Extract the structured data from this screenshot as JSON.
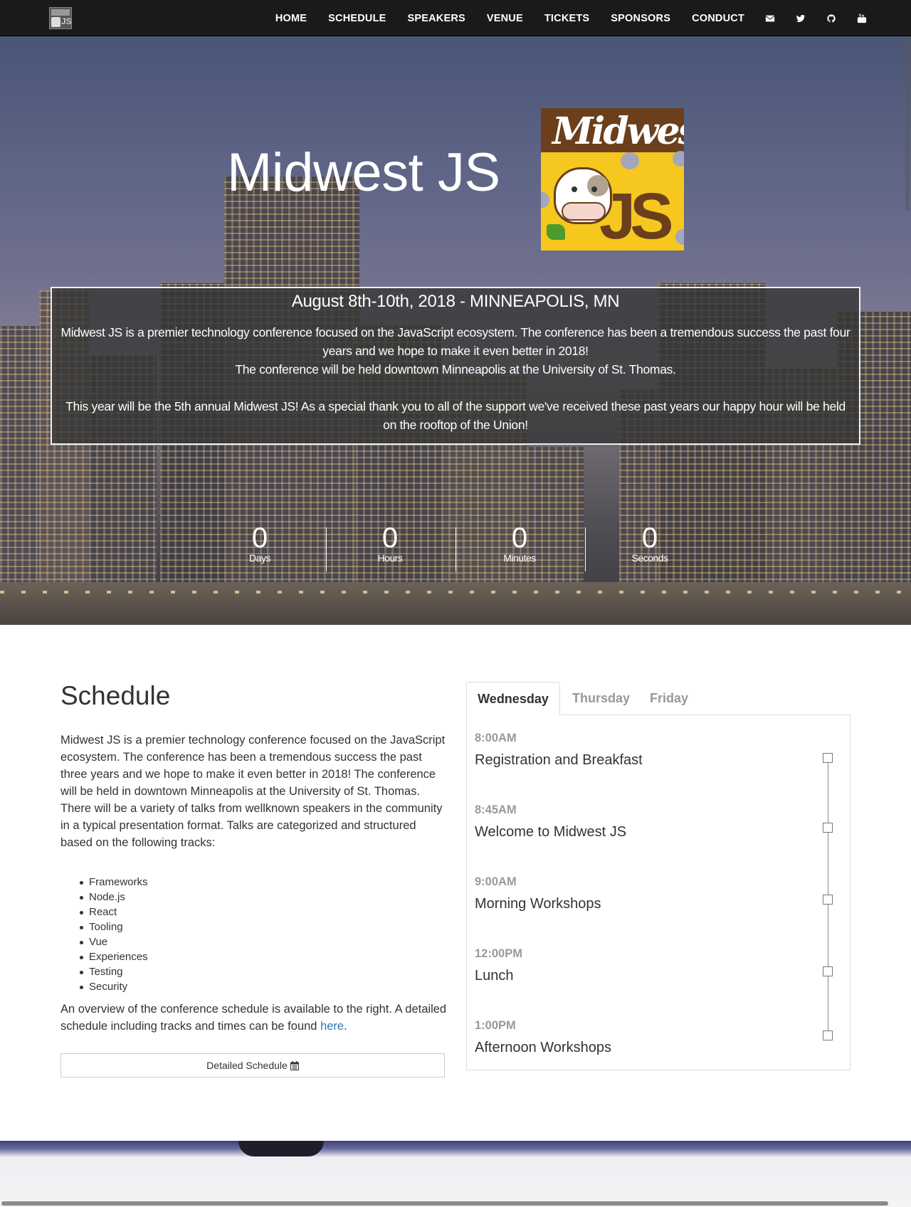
{
  "nav": {
    "links": [
      "HOME",
      "SCHEDULE",
      "SPEAKERS",
      "VENUE",
      "TICKETS",
      "SPONSORS",
      "CONDUCT"
    ],
    "icons": [
      "envelope-icon",
      "twitter-icon",
      "github-icon",
      "youtube-icon"
    ]
  },
  "hero": {
    "title": "Midwest JS",
    "logo_text": {
      "top": "Midwest",
      "bottom": "JS"
    },
    "date_line": "August 8th-10th, 2018 - MINNEAPOLIS, MN",
    "paragraph1_line1": "Midwest JS is a premier technology conference focused on the JavaScript ecosystem. The conference has been a tremendous success the past four years and we hope to make it even better in 2018!",
    "paragraph1_line2": "The conference will be held downtown Minneapolis at the University of St. Thomas.",
    "paragraph2": "This year will be the 5th annual Midwest JS! As a special thank you to all of the support we've received these past years our happy hour will be held on the rooftop of the Union!",
    "countdown": [
      {
        "value": "0",
        "label": "Days"
      },
      {
        "value": "0",
        "label": "Hours"
      },
      {
        "value": "0",
        "label": "Minutes"
      },
      {
        "value": "0",
        "label": "Seconds"
      }
    ]
  },
  "schedule": {
    "title": "Schedule",
    "intro": "Midwest JS is a premier technology conference focused on the JavaScript ecosystem. The conference has been a tremendous success the past three years and we hope to make it even better in 2018! The conference will be held in downtown Minneapolis at the University of St. Thomas.",
    "intro2": "There will be a variety of talks from wellknown speakers in the community in a typical presentation format. Talks are categorized and structured based on the following tracks:",
    "tracks": [
      "Frameworks",
      "Node.js",
      "React",
      "Tooling",
      "Vue",
      "Experiences",
      "Testing",
      "Security"
    ],
    "overview_text": "An overview of the conference schedule is available to the right. A detailed schedule including tracks and times can be found ",
    "overview_link": "here",
    "overview_end": ".",
    "detail_button": "Detailed Schedule",
    "tabs": [
      "Wednesday",
      "Thursday",
      "Friday"
    ],
    "active_tab": "Wednesday",
    "events": [
      {
        "time": "8:00AM",
        "name": "Registration and Breakfast"
      },
      {
        "time": "8:45AM",
        "name": "Welcome to Midwest JS"
      },
      {
        "time": "9:00AM",
        "name": "Morning Workshops"
      },
      {
        "time": "12:00PM",
        "name": "Lunch"
      },
      {
        "time": "1:00PM",
        "name": "Afternoon Workshops"
      }
    ]
  },
  "colors": {
    "nav_bg": "#1a1a1a",
    "logo_yellow": "#f6c71e",
    "logo_brown": "#6b3f1c",
    "link": "#337ab7"
  }
}
